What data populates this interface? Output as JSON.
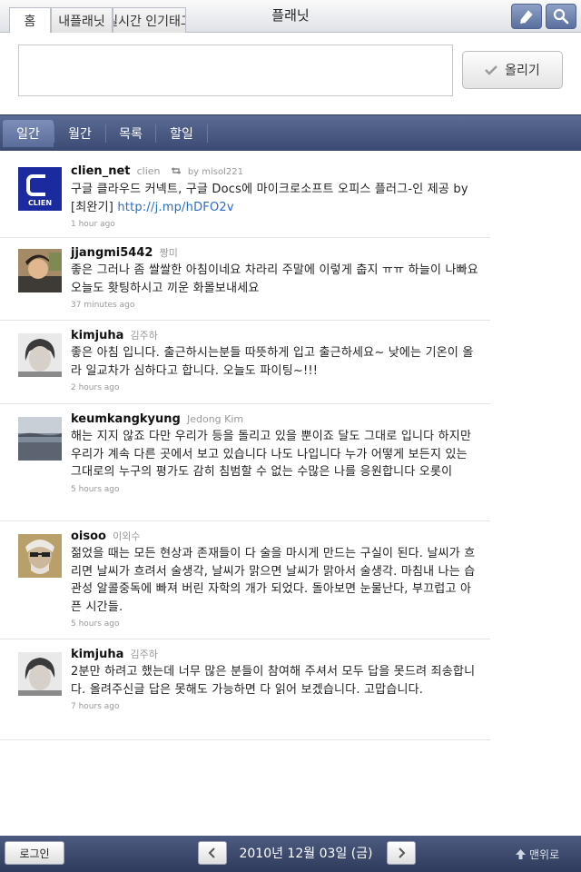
{
  "header": {
    "tabs": [
      {
        "label": "홈",
        "active": true
      },
      {
        "label": "내플래닛",
        "active": false
      },
      {
        "label": "실시간 인기태그",
        "active": false
      }
    ],
    "title": "플래닛",
    "icons": [
      "edit-icon",
      "search-icon"
    ],
    "accent": "#5a6f9f"
  },
  "compose": {
    "value": "",
    "post_label": "올리기"
  },
  "nav": {
    "tabs": [
      {
        "label": "일간",
        "active": true
      },
      {
        "label": "월간",
        "active": false
      },
      {
        "label": "목록",
        "active": false
      },
      {
        "label": "할일",
        "active": false
      }
    ]
  },
  "feed": [
    {
      "username": "clien_net",
      "realname": "clien",
      "retweet_by": "by misol221",
      "text": "구글 클라우드 커넥트, 구글 Docs에 마이크로소프트 오피스 플러그-인 제공 by [최완기] ",
      "link": "http://j.mp/hDFO2v",
      "time": "1 hour ago",
      "avatar": "clien-logo",
      "avatar_text": "CLIEN"
    },
    {
      "username": "jjangmi5442",
      "realname": "짱미",
      "text": "좋은 그러나 좀 쌀쌀한 아침이네요 차라리 주말에 이렇게 춥지 ㅠㅠ 하늘이 나빠요 오늘도 홧팅하시고 끼운 화몰보내세요",
      "time": "37 minutes ago",
      "avatar": "user-photo"
    },
    {
      "username": "kimjuha",
      "realname": "김주하",
      "text": "좋은 아침 입니다. 출근하시는분들 따뜻하게 입고 출근하세요~ 낮에는 기온이 올라 일교차가 심하다고 합니다. 오늘도 파이팅~!!!",
      "time": "2 hours ago",
      "avatar": "user-photo"
    },
    {
      "username": "keumkangkyung",
      "realname": "Jedong Kim",
      "text": "해는 지지 않죠 다만 우리가 등을 돌리고 있을 뿐이죠 달도 그대로 입니다 하지만 우리가 계속 다른 곳에서 보고 있습니다 나도 나입니다 누가 어떻게 보든지 있는 그대로의 누구의 평가도 감히 침범할 수 없는 수많은 나를 응원합니다 오롯이",
      "time": "5 hours ago",
      "avatar": "landscape-photo"
    },
    {
      "username": "oisoo",
      "realname": "이외수",
      "text": "젊었을 때는 모든 현상과 존재들이 다 술을 마시게 만드는 구실이 된다. 날씨가 흐리면 날씨가 흐려서 술생각, 날씨가 맑으면 날씨가 맑아서 술생각. 마침내 나는 습관성 알콜중독에 빠져 버린 자학의 개가 되었다. 돌아보면 눈물난다, 부끄럽고 아픈 시간들.",
      "time": "5 hours ago",
      "avatar": "user-photo"
    },
    {
      "username": "kimjuha",
      "realname": "김주하",
      "text": "2분만 하려고 했는데 너무 많은 분들이 참여해 주셔서 모두 답을 못드려 죄송합니다. 올려주신글 답은 못해도 가능하면 다 읽어 보겠습니다. 고맙습니다.",
      "time": "7 hours ago",
      "avatar": "user-photo"
    }
  ],
  "footer": {
    "login_label": "로그인",
    "date_label": "2010년 12월 03일 (금)",
    "top_label": "맨위로"
  }
}
